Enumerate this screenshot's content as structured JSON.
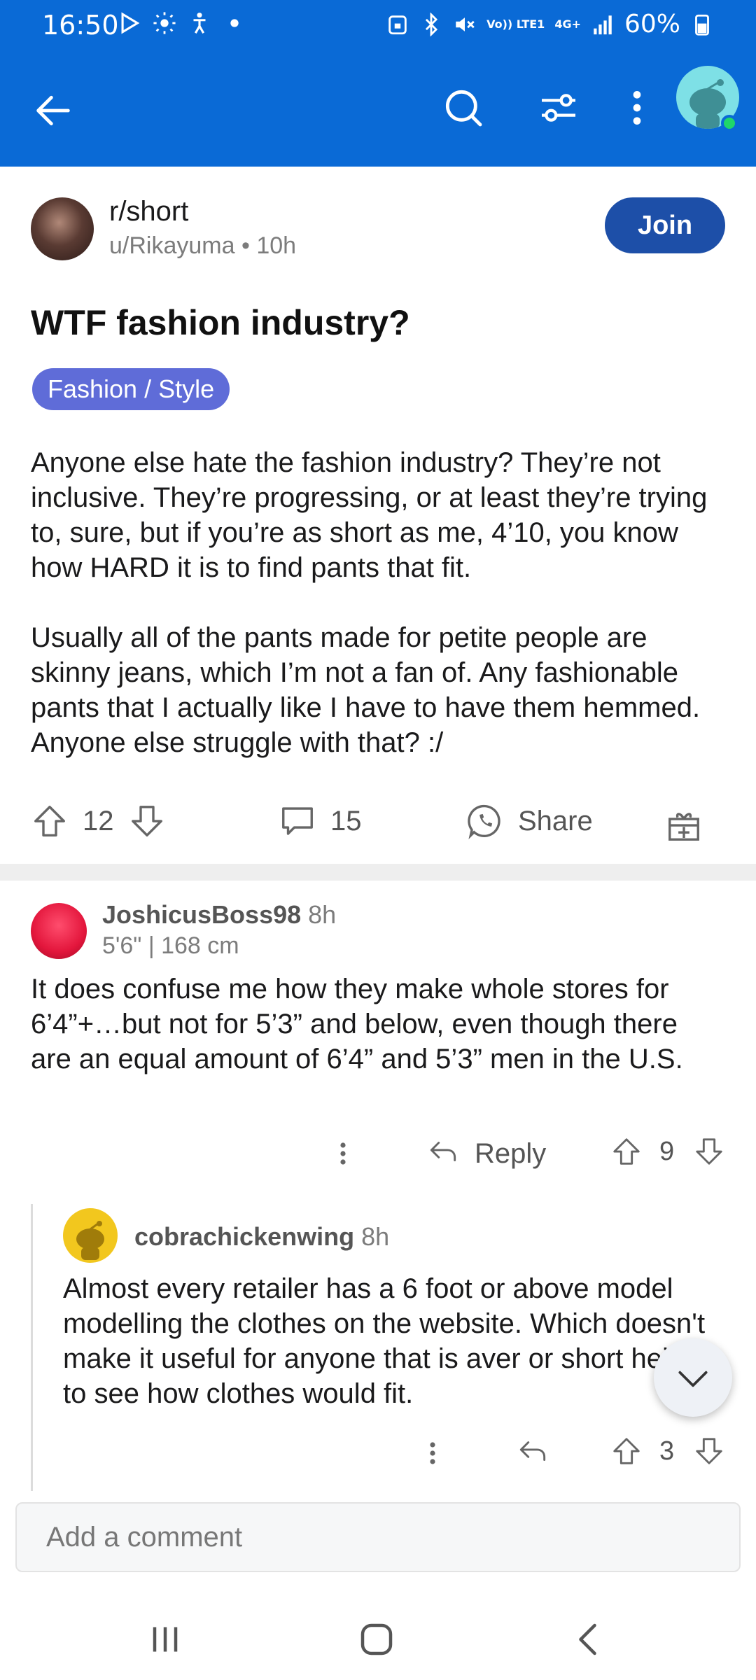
{
  "status": {
    "time": "16:50",
    "network": "4G+",
    "volte": "Vo)) LTE1",
    "battery": "60%"
  },
  "appbar": {
    "back": "back-icon",
    "search": "search-icon",
    "filter": "filter-icon",
    "more": "more-icon"
  },
  "post": {
    "subreddit": "r/short",
    "author": "u/Rikayuma",
    "age": "10h",
    "meta_separator": " • ",
    "join_label": "Join",
    "title": "WTF fashion industry?",
    "flair": "Fashion / Style",
    "body": [
      "Anyone else hate the fashion industry? They’re not inclusive. They’re progressing, or at least they’re trying to, sure, but if you’re as short as me, 4’10, you know how HARD it is to find pants that fit.",
      "Usually all of the pants made for petite people are skinny jeans, which I’m not a fan of. Any fashionable pants that I actually like I have to have them hemmed. Anyone else struggle with that? :/"
    ],
    "upvotes": "12",
    "comments": "15",
    "share_label": "Share"
  },
  "comments": [
    {
      "author": "JoshicusBoss98",
      "age": "8h",
      "flair": "5'6\" | 168 cm",
      "body": "It does confuse me how they make whole stores for 6’4”+…but not for 5’3” and below, even though there are an equal amount of 6’4” and 5’3” men in the U.S.",
      "reply_label": "Reply",
      "votes": "9"
    },
    {
      "author": "cobrachickenwing",
      "age": "8h",
      "body": "Almost every retailer has a 6 foot or above model modelling the clothes on the website. Which doesn't make it useful for anyone that is aver or short height to see how clothes would fit.",
      "votes": "3"
    }
  ],
  "composer": {
    "placeholder": "Add a comment"
  },
  "colors": {
    "brand_blue": "#0a6ad6",
    "join_blue": "#1d4fa8",
    "flair_purple": "#5f6cd8"
  }
}
